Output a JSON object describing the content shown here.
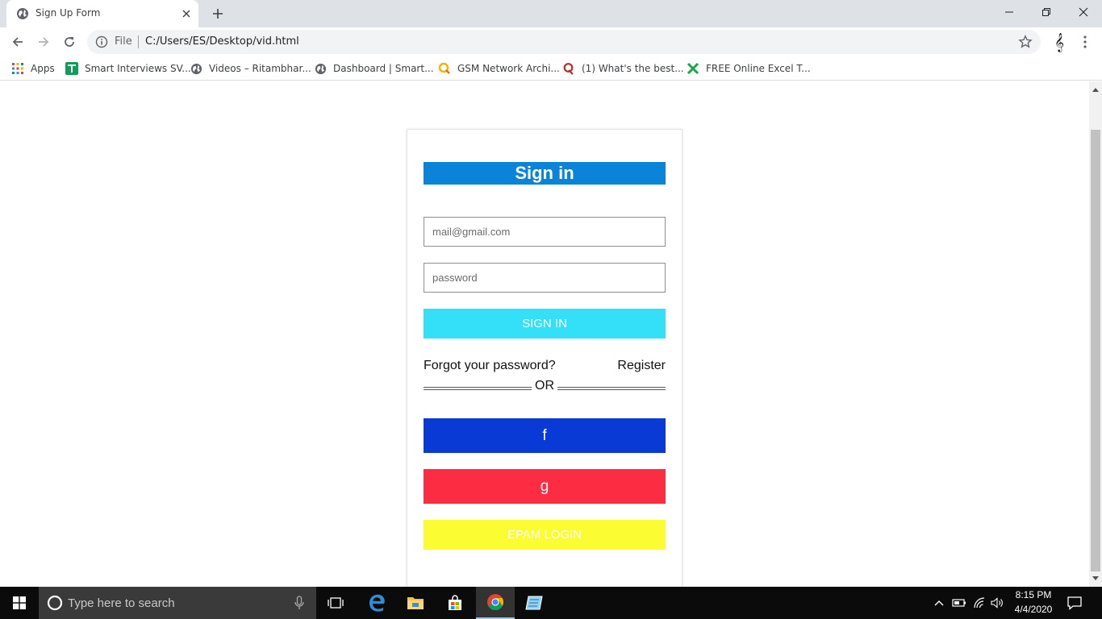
{
  "browser": {
    "tab": {
      "title": "Sign Up Form"
    },
    "address_bar": {
      "scheme_label": "File",
      "url": "C:/Users/ES/Desktop/vid.html"
    },
    "bookmarks": [
      {
        "label": "Apps",
        "icon": "apps-grid-icon"
      },
      {
        "label": "Smart Interviews SV...",
        "icon": "smart-interviews-icon"
      },
      {
        "label": "Videos – Ritambhar...",
        "icon": "globe-icon"
      },
      {
        "label": "Dashboard | Smart...",
        "icon": "globe-icon"
      },
      {
        "label": "GSM Network Archi...",
        "icon": "search-q-icon"
      },
      {
        "label": "(1) What's the best...",
        "icon": "quora-icon"
      },
      {
        "label": "FREE Online Excel T...",
        "icon": "excel-x-icon"
      }
    ]
  },
  "form": {
    "title": "Sign in",
    "email_placeholder": "mail@gmail.com",
    "password_placeholder": "password",
    "signin_button": "SIGN IN",
    "forgot_link": "Forgot your password?",
    "register_link": "Register",
    "divider_text": "OR",
    "facebook_button": "f",
    "google_button": "g",
    "epam_button": "EPAM LOGIN"
  },
  "colors": {
    "title_bg": "#0a84d8",
    "signin_bg": "#33e0f8",
    "facebook_bg": "#0a3ad6",
    "google_bg": "#fc2d43",
    "epam_bg": "#fcfc32"
  },
  "taskbar": {
    "search_placeholder": "Type here to search",
    "time": "8:15 PM",
    "date": "4/4/2020"
  }
}
